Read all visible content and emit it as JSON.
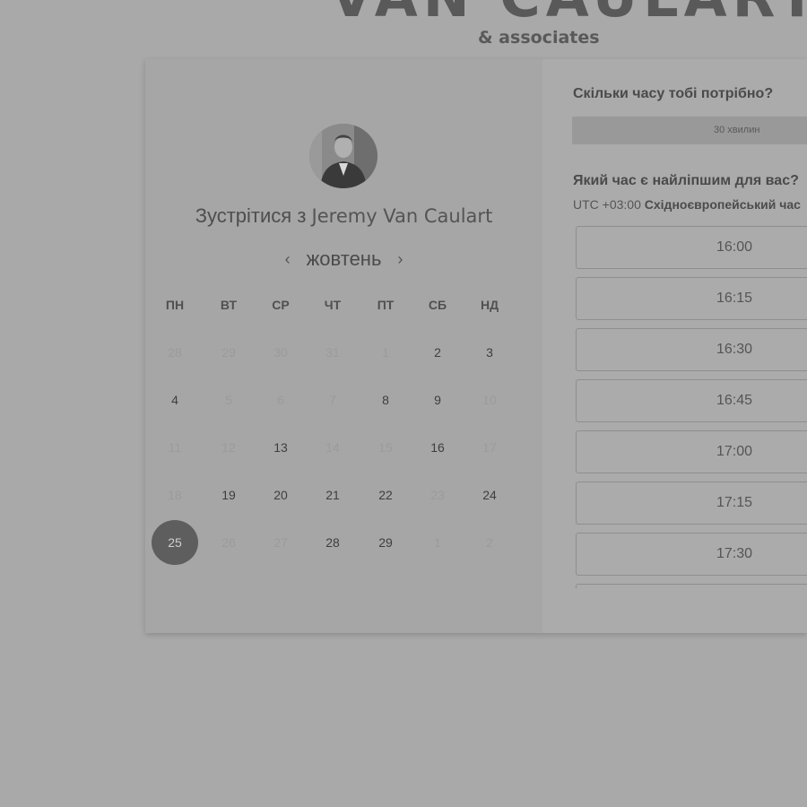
{
  "brand": {
    "name": "VAN CAULART",
    "subtitle": "& associates"
  },
  "meeting": {
    "title_prefix": "Зустрітися з",
    "host": "Jeremy Van Caulart",
    "avatar_icon": "person-portrait-icon"
  },
  "calendar": {
    "month": "жовтень",
    "prev_icon": "chevron-left-icon",
    "next_icon": "chevron-right-icon",
    "prev_glyph": "‹",
    "next_glyph": "›",
    "weekdays": [
      "ПН",
      "ВТ",
      "СР",
      "ЧТ",
      "ПТ",
      "СБ",
      "НД"
    ],
    "weeks": [
      [
        {
          "d": "28",
          "s": "muted"
        },
        {
          "d": "29",
          "s": "muted"
        },
        {
          "d": "30",
          "s": "muted"
        },
        {
          "d": "31",
          "s": "muted"
        },
        {
          "d": "1",
          "s": "muted"
        },
        {
          "d": "2",
          "s": "available"
        },
        {
          "d": "3",
          "s": "available"
        }
      ],
      [
        {
          "d": "4",
          "s": "available"
        },
        {
          "d": "5",
          "s": "muted"
        },
        {
          "d": "6",
          "s": "muted"
        },
        {
          "d": "7",
          "s": "muted"
        },
        {
          "d": "8",
          "s": "available"
        },
        {
          "d": "9",
          "s": "available"
        },
        {
          "d": "10",
          "s": "muted"
        }
      ],
      [
        {
          "d": "11",
          "s": "muted"
        },
        {
          "d": "12",
          "s": "muted"
        },
        {
          "d": "13",
          "s": "available"
        },
        {
          "d": "14",
          "s": "muted"
        },
        {
          "d": "15",
          "s": "muted"
        },
        {
          "d": "16",
          "s": "available"
        },
        {
          "d": "17",
          "s": "muted"
        }
      ],
      [
        {
          "d": "18",
          "s": "muted"
        },
        {
          "d": "19",
          "s": "available"
        },
        {
          "d": "20",
          "s": "available"
        },
        {
          "d": "21",
          "s": "available"
        },
        {
          "d": "22",
          "s": "available"
        },
        {
          "d": "23",
          "s": "muted"
        },
        {
          "d": "24",
          "s": "available"
        }
      ],
      [
        {
          "d": "25",
          "s": "selected"
        },
        {
          "d": "26",
          "s": "muted"
        },
        {
          "d": "27",
          "s": "muted"
        },
        {
          "d": "28",
          "s": "available"
        },
        {
          "d": "29",
          "s": "available"
        },
        {
          "d": "1",
          "s": "muted"
        },
        {
          "d": "2",
          "s": "muted"
        }
      ]
    ]
  },
  "booking": {
    "duration_question": "Скільки часу тобі потрібно?",
    "duration_value": "30 хвилин",
    "time_question": "Який час є найліпшим для вас?",
    "timezone_offset": "UTC +03:00",
    "timezone_name": "Східноєвропейський час",
    "slots": [
      "16:00",
      "16:15",
      "16:30",
      "16:45",
      "17:00",
      "17:15",
      "17:30",
      ""
    ]
  }
}
